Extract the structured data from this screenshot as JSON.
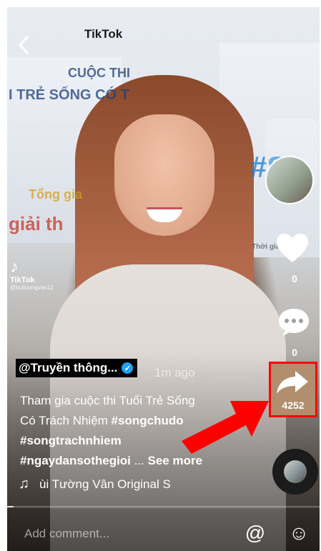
{
  "background": {
    "app_logo_text": "TikTok",
    "banner_lines": [
      "CUỘC THI",
      "I TRẺ SỐNG CÓ T",
      "Tổng gia",
      "giải th",
      "#S",
      "Thời gian"
    ]
  },
  "watermark": {
    "logo": "♪",
    "name": "TikTok",
    "user": "@buituongvan12"
  },
  "rail": {
    "like_count": "0",
    "comment_count": "0",
    "share_count": "4252"
  },
  "post": {
    "username": "@Truyền thông...",
    "verified_glyph": "✓",
    "time": "1m ago",
    "caption_line1": "Tham gia cuộc thi Tuổi Trẻ Sống",
    "caption_line2_text": "Có Trách Nhiệm ",
    "caption_line2_tag": "#songchudo",
    "caption_line3_tag": "#songtrachnhiem",
    "caption_line4_tag": "#ngaydansothegioi",
    "caption_ellipsis": " ... ",
    "see_more": "See more",
    "music": "ùi Tường Vân Original S"
  },
  "progress_fraction": 0.02,
  "comment_bar": {
    "placeholder": "Add comment...",
    "mention_icon": "@",
    "emoji_icon": "☺"
  },
  "colors": {
    "highlight": "#ff0000",
    "verified": "#1fa3f0"
  },
  "icons": [
    "back-icon",
    "heart-icon",
    "comment-icon",
    "share-icon",
    "music-note-icon",
    "mention-icon",
    "emoji-icon"
  ]
}
